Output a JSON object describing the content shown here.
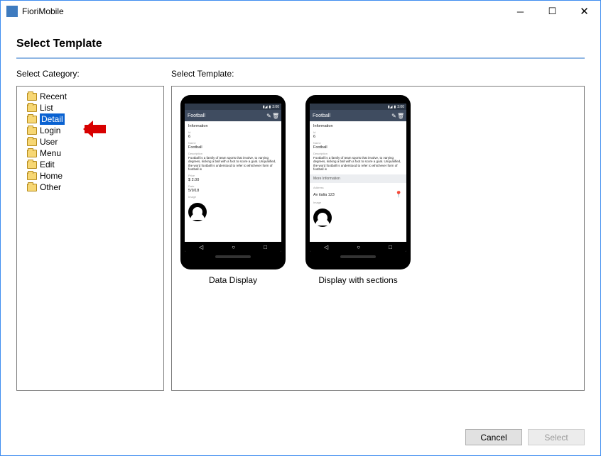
{
  "window": {
    "title": "FioriMobile"
  },
  "page": {
    "heading": "Select Template"
  },
  "labels": {
    "category": "Select Category:",
    "template": "Select Template:"
  },
  "categories": [
    {
      "label": "Recent",
      "selected": false
    },
    {
      "label": "List",
      "selected": false
    },
    {
      "label": "Detail",
      "selected": true
    },
    {
      "label": "Login",
      "selected": false
    },
    {
      "label": "User",
      "selected": false
    },
    {
      "label": "Menu",
      "selected": false
    },
    {
      "label": "Edit",
      "selected": false
    },
    {
      "label": "Home",
      "selected": false
    },
    {
      "label": "Other",
      "selected": false
    }
  ],
  "templates": [
    {
      "label": "Data Display"
    },
    {
      "label": "Display with sections"
    }
  ],
  "mock": {
    "appTitle": "Football",
    "infoHeader": "Information",
    "idLabel": "Id",
    "idValue": "6",
    "nameLabel": "Name",
    "nameValue": "Football",
    "descLabel": "Description",
    "descValue": "Football is a family of team sports that involve, to varying degrees, kicking a ball with a foot to score a goal. Unqualified, the word football is understood to refer to whichever form of football is",
    "priceLabel": "Price",
    "priceValue": "$   2.00",
    "dateLabel": "Date",
    "dateValue": "5/9/18",
    "imageLabel": "Image",
    "moreInfo": "More Information",
    "addressLabel": "Address",
    "addressValue": "Av italia 123"
  },
  "footer": {
    "cancel": "Cancel",
    "select": "Select"
  }
}
